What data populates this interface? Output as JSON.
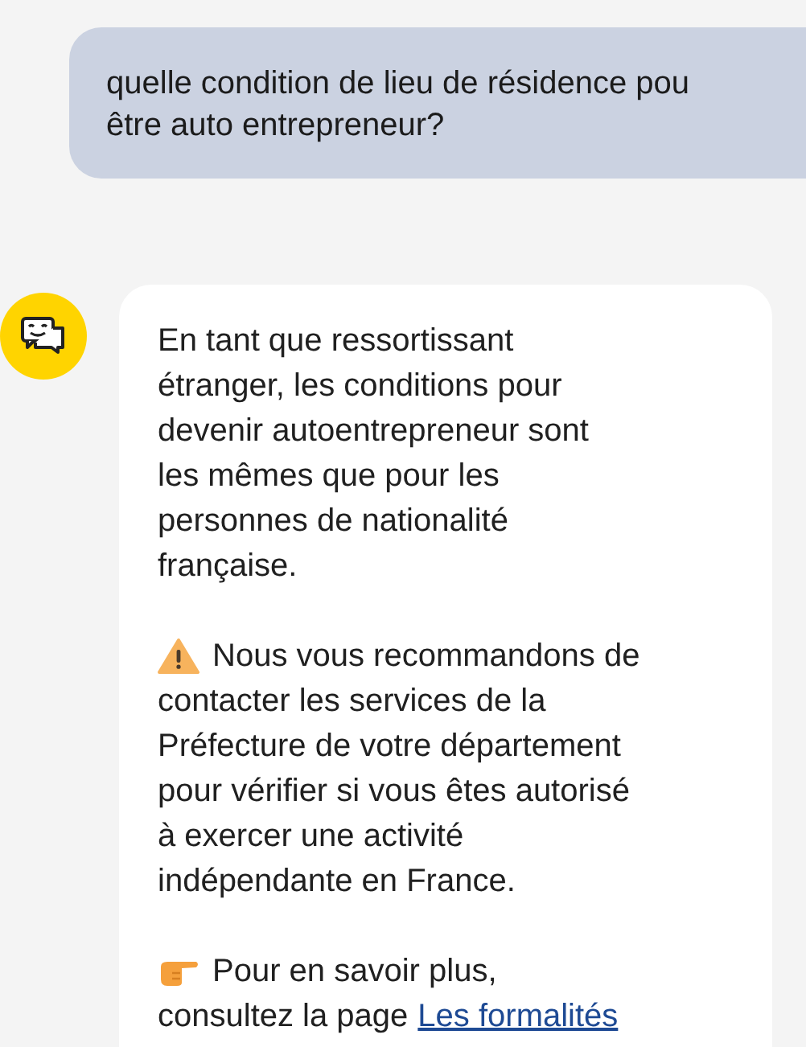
{
  "messages": [
    {
      "kind": "user",
      "lines": [
        "quelle condition de lieu de résidence pou",
        "être auto entrepreneur?"
      ]
    },
    {
      "kind": "bot",
      "paragraphs": [
        {
          "kind": "plain",
          "lines": [
            "En tant que ressortissant",
            "étranger, les conditions pour",
            "devenir autoentrepreneur sont",
            "les mêmes que pour les",
            "personnes de nationalité",
            "française."
          ]
        },
        {
          "kind": "warning",
          "lines": [
            "Nous vous recommandons de",
            "contacter les services de la",
            "Préfecture de votre département",
            "pour vérifier si vous êtes autorisé",
            "à exercer une activité",
            "indépendante en France."
          ]
        },
        {
          "kind": "tip",
          "lines": [
            "Pour en savoir plus,",
            "consultez la page"
          ],
          "link": "Les formalités"
        }
      ]
    }
  ]
}
